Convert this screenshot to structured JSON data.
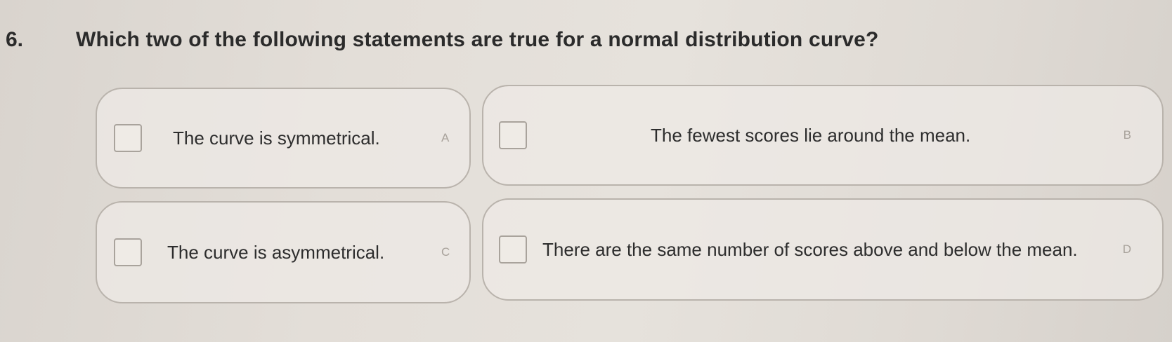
{
  "question": {
    "number": "6.",
    "text": "Which two of the following statements are true for a normal distribution curve?"
  },
  "options": [
    {
      "letter": "A",
      "text": "The curve is symmetrical.",
      "checked": false
    },
    {
      "letter": "B",
      "text": "The fewest scores lie around the mean.",
      "checked": false
    },
    {
      "letter": "C",
      "text": "The curve is asymmetrical.",
      "checked": false
    },
    {
      "letter": "D",
      "text": "There are the same number of scores above and below the mean.",
      "checked": false
    }
  ]
}
